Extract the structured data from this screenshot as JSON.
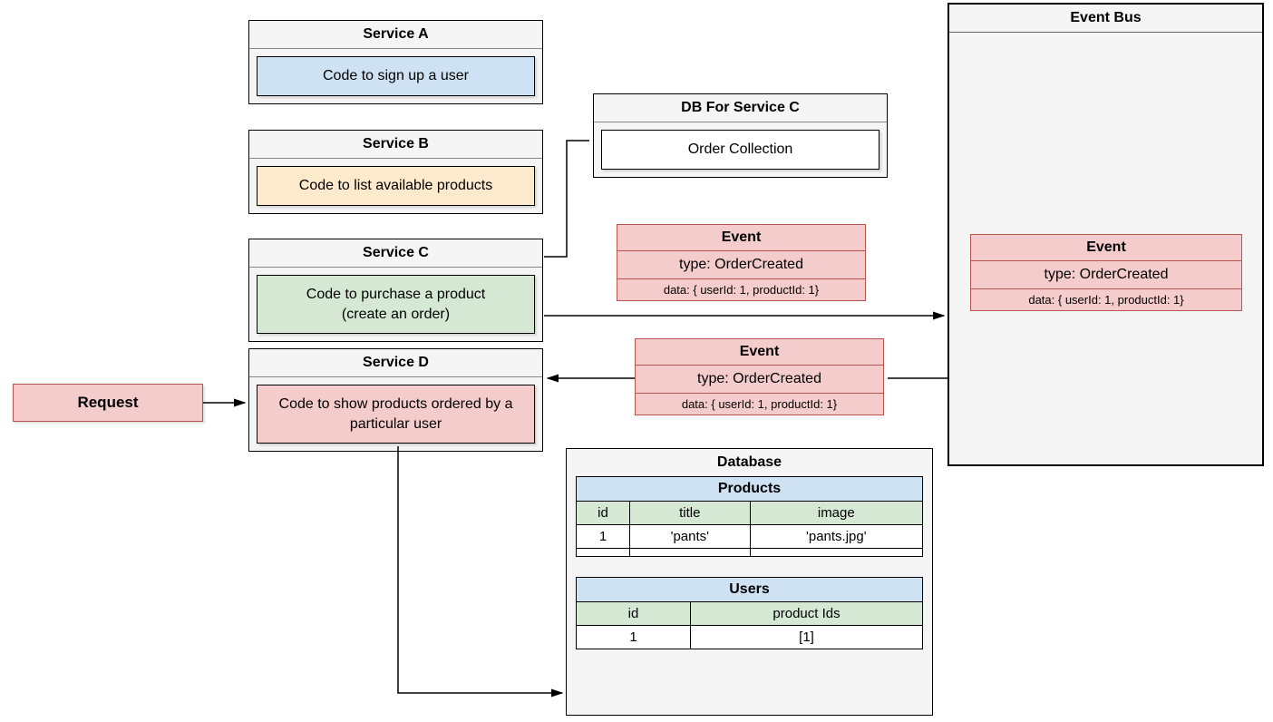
{
  "request": {
    "label": "Request"
  },
  "services": {
    "A": {
      "title": "Service A",
      "desc": "Code to sign up a user"
    },
    "B": {
      "title": "Service B",
      "desc": "Code to list available products"
    },
    "C": {
      "title": "Service C",
      "desc": "Code to purchase a product\n(create an order)"
    },
    "D": {
      "title": "Service D",
      "desc": "Code to show products ordered by a particular user"
    }
  },
  "dbForC": {
    "title": "DB For Service C",
    "collection": "Order Collection"
  },
  "eventBus": {
    "title": "Event Bus"
  },
  "events": {
    "top": {
      "title": "Event",
      "type": "type: OrderCreated",
      "data": "data: { userId: 1, productId: 1}"
    },
    "bottom": {
      "title": "Event",
      "type": "type: OrderCreated",
      "data": "data: { userId: 1, productId: 1}"
    },
    "bus": {
      "title": "Event",
      "type": "type: OrderCreated",
      "data": "data: { userId: 1, productId: 1}"
    }
  },
  "database": {
    "title": "Database",
    "products": {
      "name": "Products",
      "cols": [
        "id",
        "title",
        "image"
      ],
      "rows": [
        [
          "1",
          "'pants'",
          "'pants.jpg'"
        ],
        [
          "",
          "",
          ""
        ]
      ]
    },
    "users": {
      "name": "Users",
      "cols": [
        "id",
        "product Ids"
      ],
      "rows": [
        [
          "1",
          "[1]"
        ]
      ]
    }
  }
}
